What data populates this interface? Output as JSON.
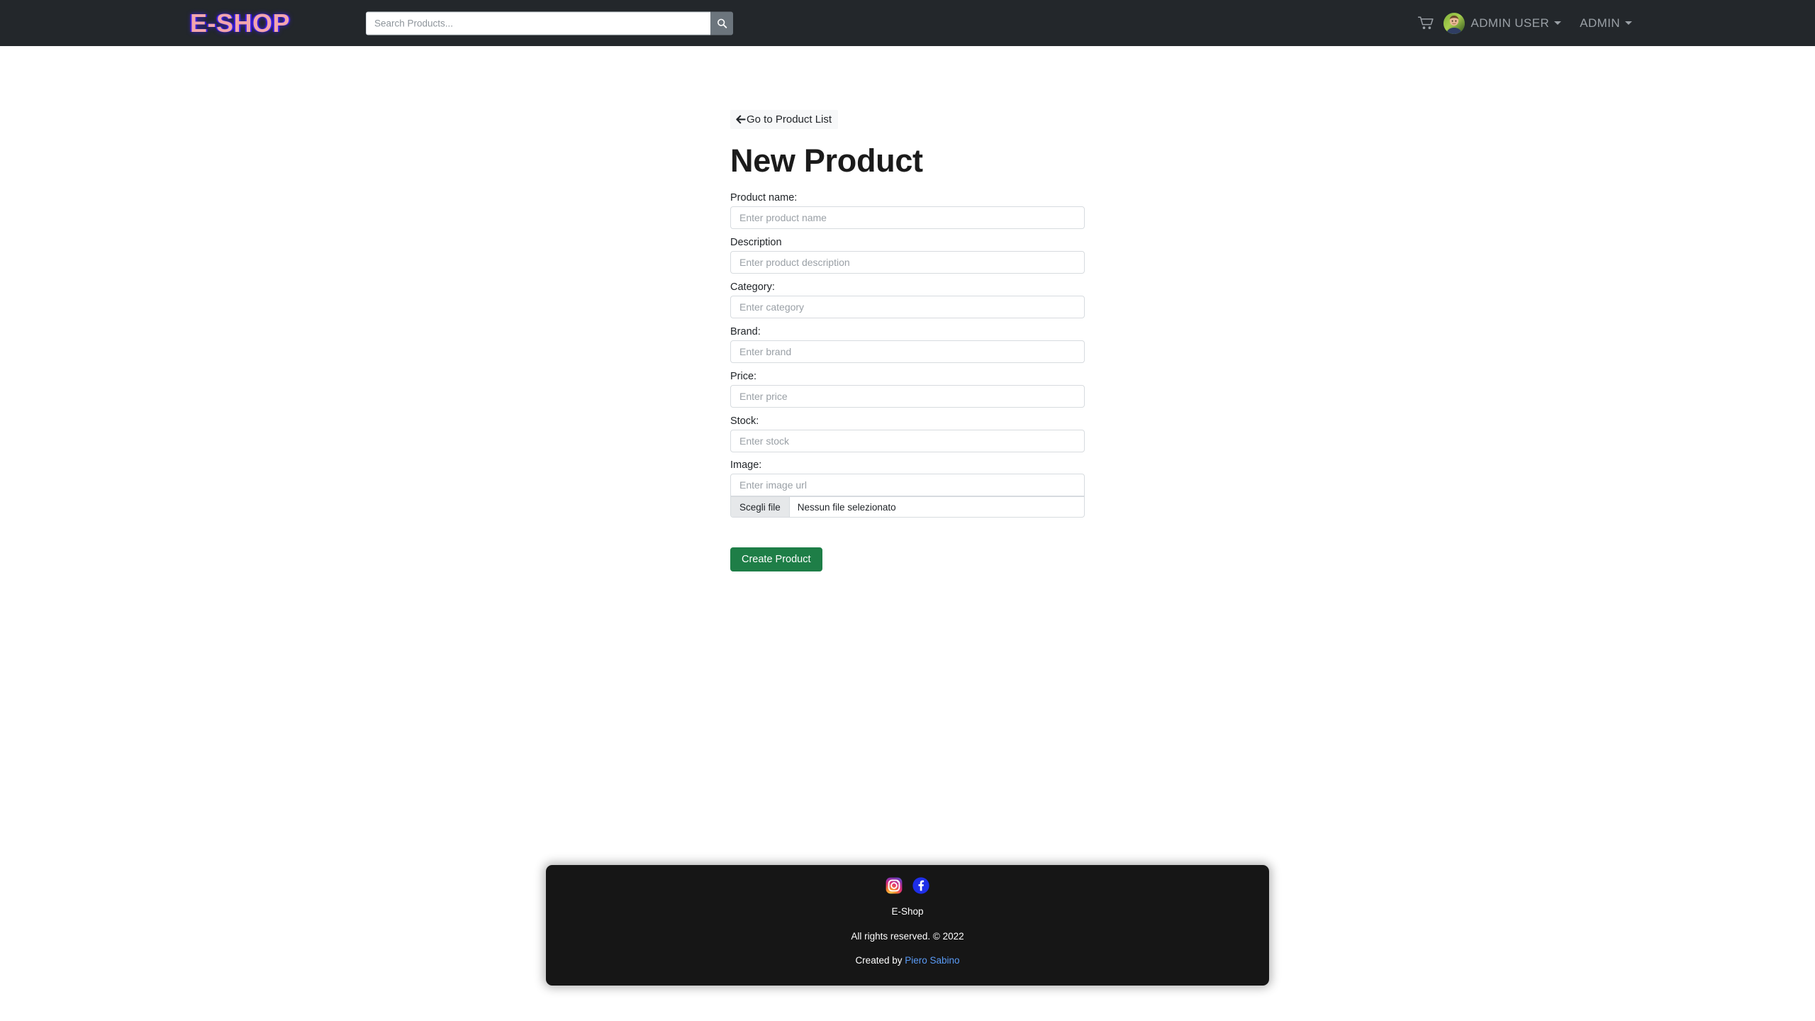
{
  "navbar": {
    "brand": "E-SHOP",
    "search": {
      "placeholder": "Search Products...",
      "value": "",
      "button_icon": "search-icon"
    },
    "cart_icon": "shopping-cart-icon",
    "avatar_alt": "admin user avatar",
    "user_menu_label": "ADMIN USER",
    "admin_menu_label": "ADMIN"
  },
  "main": {
    "back_link_label": "Go to Product List",
    "back_link_icon": "arrow-left-icon",
    "page_title": "New Product",
    "fields": [
      {
        "label": "Product name:",
        "placeholder": "Enter product name",
        "value": "",
        "name": "product-name"
      },
      {
        "label": "Description",
        "placeholder": "Enter product description",
        "value": "",
        "name": "description"
      },
      {
        "label": "Category:",
        "placeholder": "Enter category",
        "value": "",
        "name": "category"
      },
      {
        "label": "Brand:",
        "placeholder": "Enter brand",
        "value": "",
        "name": "brand"
      },
      {
        "label": "Price:",
        "placeholder": "Enter price",
        "value": "",
        "name": "price"
      },
      {
        "label": "Stock:",
        "placeholder": "Enter stock",
        "value": "",
        "name": "stock"
      }
    ],
    "image_field": {
      "label": "Image:",
      "url_placeholder": "Enter image url",
      "url_value": "",
      "file_button_label": "Scegli file",
      "file_status": "Nessun file selezionato"
    },
    "submit_label": "Create Product"
  },
  "footer": {
    "socials": [
      {
        "name": "instagram-icon",
        "label": "Instagram"
      },
      {
        "name": "facebook-icon",
        "label": "Facebook"
      }
    ],
    "site_name": "E-Shop",
    "rights": "All rights reserved. © 2022",
    "credit_prefix": "Created by ",
    "credit_name": "Piero Sabino"
  },
  "colors": {
    "navbar_bg": "#23272b",
    "brand_pink": "#f2a5ad",
    "brand_blue_glow": "#3a1ce0",
    "search_button": "#6c757d",
    "submit_green": "#1e7e47",
    "footer_bg": "#161616",
    "link_blue": "#5a9bf6",
    "nav_text": "#9aa0a6"
  }
}
